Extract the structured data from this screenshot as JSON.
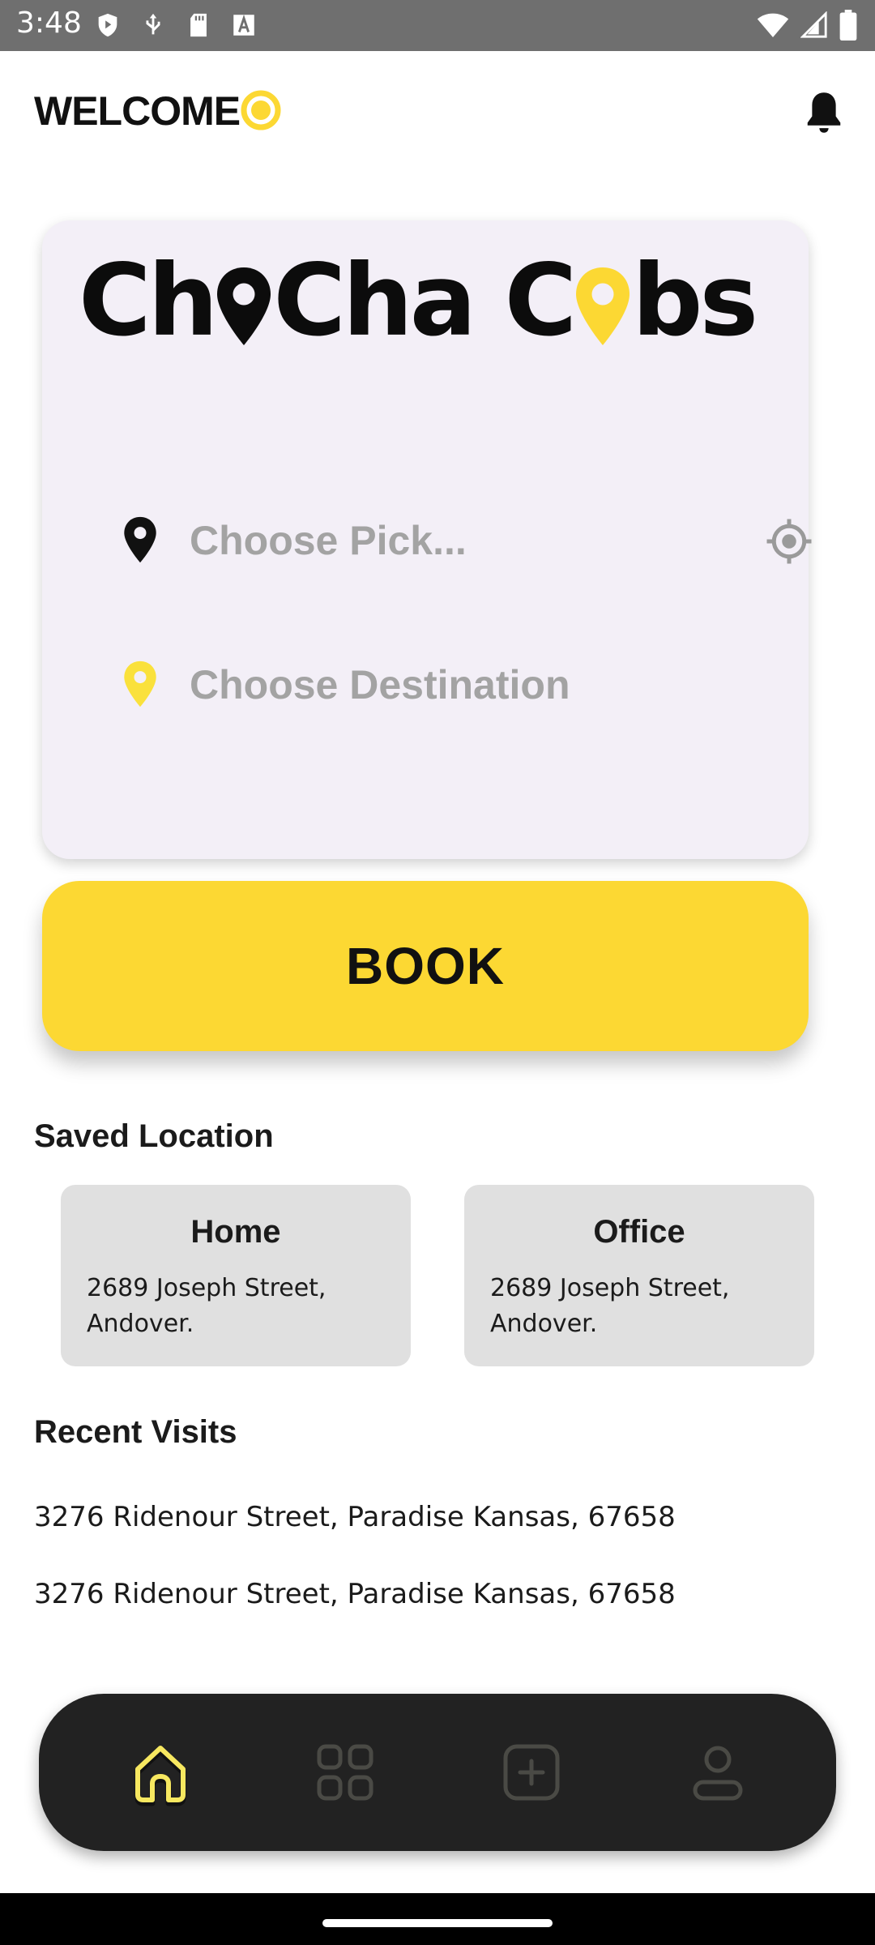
{
  "status_bar": {
    "time": "3:48",
    "left_icons": [
      "shield-play-icon",
      "usb-icon",
      "sd-card-icon",
      "font-icon"
    ],
    "right_icons": [
      "wifi-icon",
      "signal-icon",
      "battery-icon"
    ]
  },
  "header": {
    "welcome": "WELCOME",
    "accent_color": "#fcd833",
    "notification_icon": "bell-icon"
  },
  "booking_card": {
    "logo": {
      "part1": "Ch",
      "part2": "Cha C",
      "part3": "bs",
      "full_text": "ChoCha Cabs"
    },
    "pickup": {
      "placeholder": "Choose Pick...",
      "icon": "location-pin-icon",
      "action_icon": "gps-target-icon"
    },
    "destination": {
      "placeholder": "Choose Destination",
      "icon": "yellow-location-pin-icon"
    }
  },
  "book_button": {
    "label": "BOOK",
    "color": "#fcd833"
  },
  "saved_locations": {
    "title": "Saved Location",
    "items": [
      {
        "name": "Home",
        "address_line1": "2689 Joseph Street,",
        "address_line2": "Andover."
      },
      {
        "name": "Office",
        "address_line1": "2689 Joseph Street,",
        "address_line2": "Andover."
      }
    ]
  },
  "recent_visits": {
    "title": "Recent Visits",
    "items": [
      "3276 Ridenour Street, Paradise Kansas, 67658",
      "3276 Ridenour Street, Paradise Kansas, 67658"
    ]
  },
  "bottom_nav": {
    "items": [
      "home-icon",
      "grid-icon",
      "add-square-icon",
      "profile-icon"
    ],
    "active": "home-icon",
    "active_color": "#f7e860",
    "inactive_color": "#4a4a45"
  }
}
